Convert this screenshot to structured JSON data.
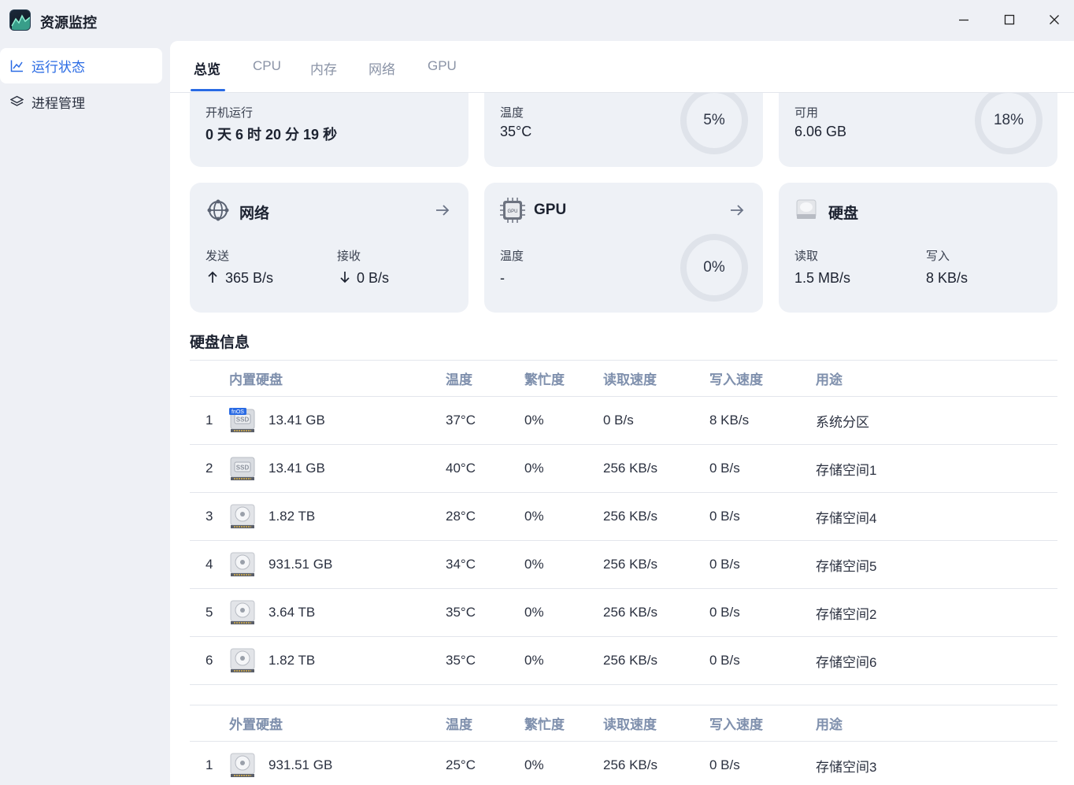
{
  "app": {
    "title": "资源监控"
  },
  "sidebar": {
    "items": [
      {
        "label": "运行状态",
        "icon": "chart-line-icon",
        "active": true
      },
      {
        "label": "进程管理",
        "icon": "layers-icon",
        "active": false
      }
    ]
  },
  "tabs": [
    {
      "label": "总览",
      "active": true
    },
    {
      "label": "CPU"
    },
    {
      "label": "内存"
    },
    {
      "label": "网络"
    },
    {
      "label": "GPU"
    }
  ],
  "cards_top": {
    "uptime": {
      "label": "开机运行",
      "value": "0 天 6 时 20 分 19 秒"
    },
    "cpu": {
      "label": "温度",
      "value": "35°C",
      "usage": "5%"
    },
    "memory": {
      "label": "可用",
      "value": "6.06 GB",
      "usage": "18%"
    }
  },
  "network_card": {
    "title": "网络",
    "send_label": "发送",
    "send_value": "365 B/s",
    "recv_label": "接收",
    "recv_value": "0 B/s"
  },
  "gpu_card": {
    "title": "GPU",
    "temp_label": "温度",
    "temp_value": "-",
    "usage": "0%"
  },
  "disk_card": {
    "title": "硬盘",
    "read_label": "读取",
    "read_value": "1.5 MB/s",
    "write_label": "写入",
    "write_value": "8 KB/s"
  },
  "disk_section": {
    "title": "硬盘信息"
  },
  "internal": {
    "headers": [
      "内置硬盘",
      "温度",
      "繁忙度",
      "读取速度",
      "写入速度",
      "用途"
    ],
    "rows": [
      {
        "n": "1",
        "type": "ssd-fnos",
        "cap": "13.41 GB",
        "temp": "37°C",
        "busy": "0%",
        "read": "0 B/s",
        "write": "8 KB/s",
        "use": "系统分区"
      },
      {
        "n": "2",
        "type": "ssd",
        "cap": "13.41 GB",
        "temp": "40°C",
        "busy": "0%",
        "read": "256 KB/s",
        "write": "0 B/s",
        "use": "存储空间1"
      },
      {
        "n": "3",
        "type": "hdd",
        "cap": "1.82 TB",
        "temp": "28°C",
        "busy": "0%",
        "read": "256 KB/s",
        "write": "0 B/s",
        "use": "存储空间4"
      },
      {
        "n": "4",
        "type": "hdd",
        "cap": "931.51 GB",
        "temp": "34°C",
        "busy": "0%",
        "read": "256 KB/s",
        "write": "0 B/s",
        "use": "存储空间5"
      },
      {
        "n": "5",
        "type": "hdd",
        "cap": "3.64 TB",
        "temp": "35°C",
        "busy": "0%",
        "read": "256 KB/s",
        "write": "0 B/s",
        "use": "存储空间2"
      },
      {
        "n": "6",
        "type": "hdd",
        "cap": "1.82 TB",
        "temp": "35°C",
        "busy": "0%",
        "read": "256 KB/s",
        "write": "0 B/s",
        "use": "存储空间6"
      }
    ]
  },
  "external": {
    "headers": [
      "外置硬盘",
      "温度",
      "繁忙度",
      "读取速度",
      "写入速度",
      "用途"
    ],
    "rows": [
      {
        "n": "1",
        "type": "hdd",
        "cap": "931.51 GB",
        "temp": "25°C",
        "busy": "0%",
        "read": "256 KB/s",
        "write": "0 B/s",
        "use": "存储空间3"
      }
    ]
  },
  "icons": {
    "ssd_badge": "fnOS",
    "ssd_label": "SSD",
    "gpu_chip": "GPU"
  },
  "colors": {
    "accent": "#2a6be4",
    "header_text": "#7f90ad",
    "card_bg": "#eef1f6"
  }
}
